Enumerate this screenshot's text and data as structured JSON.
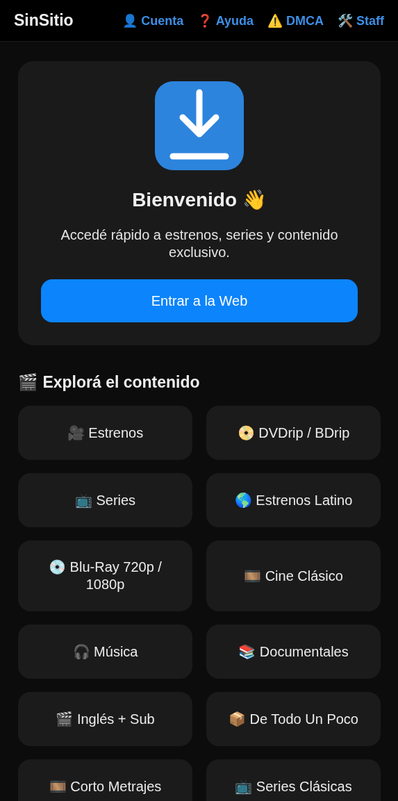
{
  "header": {
    "brand": "SinSitio",
    "links": [
      {
        "label": "👤 Cuenta"
      },
      {
        "label": "❓ Ayuda"
      },
      {
        "label": "⚠️ DMCA"
      },
      {
        "label": "🛠️ Staff"
      }
    ]
  },
  "welcome": {
    "title": "Bienvenido 👋",
    "text": "Accedé rápido a estrenos, series y contenido exclusivo.",
    "button": "Entrar a la Web"
  },
  "section": {
    "heading": "🎬 Explorá el contenido",
    "tiles": [
      {
        "label": "🎥 Estrenos"
      },
      {
        "label": "📀 DVDrip / BDrip"
      },
      {
        "label": "📺 Series"
      },
      {
        "label": "🌎 Estrenos Latino"
      },
      {
        "label": "💿 Blu-Ray 720p / 1080p"
      },
      {
        "label": "🎞️ Cine Clásico"
      },
      {
        "label": "🎧 Música"
      },
      {
        "label": "📚 Documentales"
      },
      {
        "label": "🎬 Inglés + Sub"
      },
      {
        "label": "📦 De Todo Un Poco"
      },
      {
        "label": "🎞️ Corto Metrajes"
      },
      {
        "label": "📺 Series Clásicas"
      }
    ]
  }
}
